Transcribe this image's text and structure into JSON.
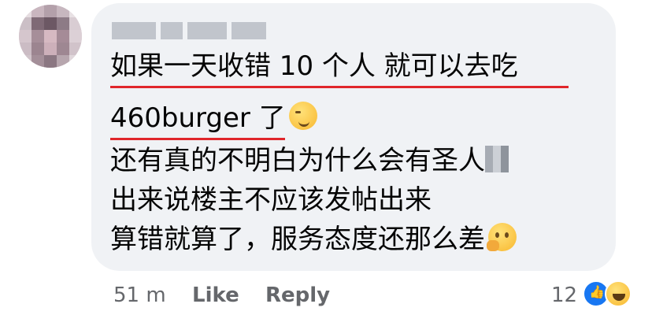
{
  "comment": {
    "author_name_blurred": "",
    "lines": [
      "如果一天收错 10 个人 就可以去吃",
      "460burger 了",
      "还有真的不明白为什么会有圣人",
      "出来说楼主不应该发帖出来",
      "算错就算了，服务态度还那么差"
    ],
    "emoji_line2": "smirk-emoji",
    "emoji_line5": "thinking-emoji"
  },
  "footer": {
    "time": "51 m",
    "like_label": "Like",
    "reply_label": "Reply",
    "reaction_count": "12",
    "reactions": [
      "like",
      "haha"
    ]
  },
  "colors": {
    "bubble": "#f0f2f5",
    "underline": "#e0262b",
    "meta_text": "#65676b",
    "like_blue": "#1877f2"
  }
}
